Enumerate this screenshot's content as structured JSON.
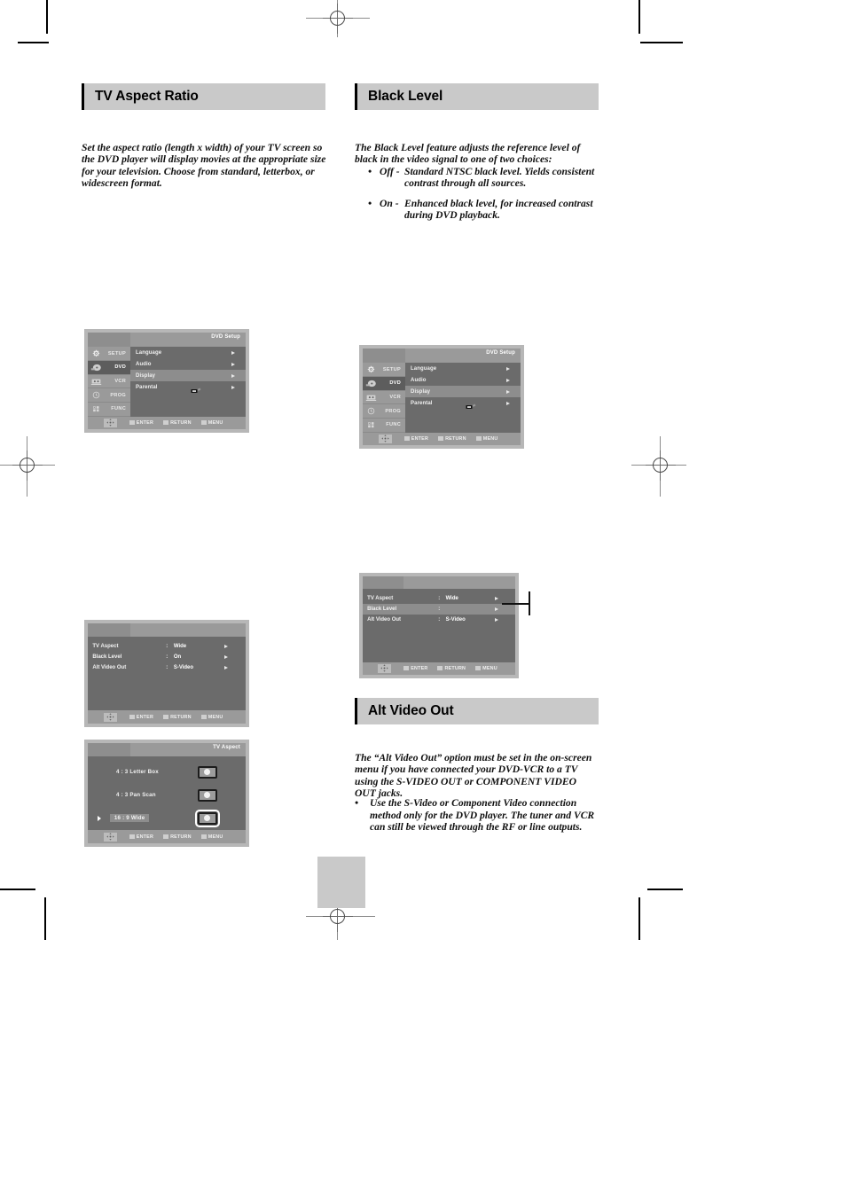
{
  "document": {
    "sections": [
      {
        "id": "tv-aspect-ratio",
        "title": "TV Aspect Ratio",
        "body": "Set the aspect ratio (length x width) of your TV screen so the DVD player will display movies at the appropriate size for your television. Choose from standard, letterbox, or widescreen format."
      },
      {
        "id": "black-level",
        "title": "Black Level",
        "body": "The Black Level feature adjusts the reference level of black in the video signal to one of two choices:",
        "bullets": [
          {
            "dot": "•",
            "key": "Off -",
            "desc": "Standard NTSC black level. Yields consistent contrast through all sources."
          },
          {
            "dot": "•",
            "key": "On -",
            "desc": "Enhanced black level, for increased contrast during DVD playback."
          }
        ]
      },
      {
        "id": "alt-video-out",
        "title": "Alt Video Out",
        "body": "The “Alt  Video Out” option must be set in the on-screen menu if you have connected your DVD-VCR to a TV using the S-VIDEO OUT or COMPONENT VIDEO OUT jacks.",
        "bullets": [
          {
            "dot": "•",
            "desc": "Use the S-Video or Component Video connection method only for the DVD player. The tuner and VCR can still be viewed through the RF or line outputs."
          }
        ]
      }
    ]
  },
  "osd": {
    "setup_screen": {
      "title": "DVD Setup",
      "sidebar": [
        {
          "label": "SETUP",
          "icon": "gear-icon",
          "selected": false
        },
        {
          "label": "DVD",
          "icon": "disc-icon",
          "selected": true
        },
        {
          "label": "VCR",
          "icon": "cassette-icon",
          "selected": false
        },
        {
          "label": "PROG",
          "icon": "clock-icon",
          "selected": false
        },
        {
          "label": "FUNC",
          "icon": "blocks-icon",
          "selected": false
        }
      ],
      "menu": [
        {
          "label": "Language",
          "highlighted": false
        },
        {
          "label": "Audio",
          "highlighted": false
        },
        {
          "label": "Display",
          "highlighted": true
        },
        {
          "label": "Parental",
          "highlighted": false,
          "cursor": true
        }
      ],
      "footer": [
        {
          "label": "ENTER"
        },
        {
          "label": "RETURN"
        },
        {
          "label": "MENU"
        }
      ]
    },
    "display_settings_full": {
      "rows": [
        {
          "label": "TV Aspect",
          "colon": ":",
          "value": "Wide",
          "highlighted": false
        },
        {
          "label": "Black Level",
          "colon": ":",
          "value": "On",
          "highlighted": false
        },
        {
          "label": "Alt Video Out",
          "colon": ":",
          "value": "S-Video",
          "highlighted": false
        }
      ],
      "footer": [
        {
          "label": "ENTER"
        },
        {
          "label": "RETURN"
        },
        {
          "label": "MENU"
        }
      ]
    },
    "display_settings_blacklevel": {
      "rows": [
        {
          "label": "TV Aspect",
          "colon": ":",
          "value": "Wide",
          "highlighted": false
        },
        {
          "label": "Black Level",
          "colon": ":",
          "value": "",
          "highlighted": true
        },
        {
          "label": "Alt Video Out",
          "colon": ":",
          "value": "S-Video",
          "highlighted": false
        }
      ],
      "footer": [
        {
          "label": "ENTER"
        },
        {
          "label": "RETURN"
        },
        {
          "label": "MENU"
        }
      ]
    },
    "tv_aspect_screen": {
      "title": "TV Aspect",
      "options": [
        {
          "label": "4 : 3  Letter Box",
          "selected": false,
          "boxed": false
        },
        {
          "label": "4 : 3 Pan Scan",
          "selected": false,
          "boxed": false
        },
        {
          "label": "16 : 9 Wide",
          "selected": true,
          "boxed": true
        }
      ],
      "footer": [
        {
          "label": "ENTER"
        },
        {
          "label": "RETURN"
        },
        {
          "label": "MENU"
        }
      ]
    }
  },
  "colors": {
    "header_bg": "#c9c9c9",
    "osd_frame": "#b7b7b7",
    "osd_body": "#6b6b6b",
    "osd_chrome": "#9a9a9a",
    "osd_highlight": "#8d8d8d",
    "text": "#101010"
  }
}
